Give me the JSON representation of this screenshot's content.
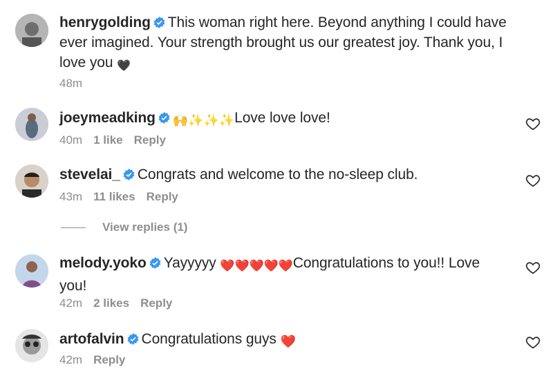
{
  "comments": [
    {
      "username": "henrygolding",
      "text": "This woman right here. Beyond anything I could have ever imagined. Your strength brought us our greatest joy. Thank you, I love you",
      "emoji_suffix": "🖤",
      "time": "48m",
      "likes": "",
      "reply": ""
    },
    {
      "username": "joeymeadking",
      "emoji_prefix": "🙌✨✨✨",
      "text": "Love love love!",
      "time": "40m",
      "likes": "1 like",
      "reply": "Reply"
    },
    {
      "username": "stevelai_",
      "text": "Congrats and welcome to the no-sleep club.",
      "time": "43m",
      "likes": "11 likes",
      "reply": "Reply"
    },
    {
      "username": "melody.yoko",
      "text_start": "Yayyyyy",
      "emoji_mid": "❤️❤️❤️❤️❤️",
      "text_end": "Congratulations to you!! Love you!",
      "time": "42m",
      "likes": "2 likes",
      "reply": "Reply"
    },
    {
      "username": "artofalvin",
      "text": "Congratulations guys",
      "emoji_suffix": "❤️",
      "time": "42m",
      "likes": "",
      "reply": "Reply"
    }
  ],
  "view_replies": "View replies (1)",
  "colors": {
    "text": "#262626",
    "muted": "#8e8e8e",
    "verified": "#3897f0"
  },
  "icons": [
    "verified-badge-icon",
    "heart-outline-icon"
  ]
}
